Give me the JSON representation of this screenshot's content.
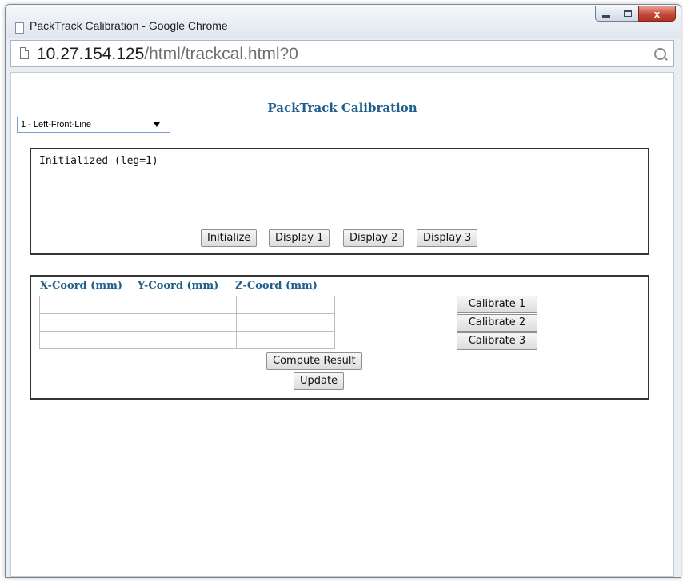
{
  "window": {
    "title": "PackTrack Calibration - Google Chrome",
    "controls": {
      "minimize": "minimize",
      "maximize": "maximize",
      "close": "x"
    }
  },
  "address_bar": {
    "host": "10.27.154.125",
    "path": "/html/trackcal.html?0"
  },
  "page": {
    "title": "PackTrack Calibration",
    "leg_select": {
      "selected": "1 - Left-Front-Line"
    },
    "status": {
      "text": "Initialized (leg=1)",
      "buttons": {
        "initialize": "Initialize",
        "display1": "Display 1",
        "display2": "Display 2",
        "display3": "Display 3"
      }
    },
    "coords": {
      "headers": {
        "x": "X-Coord (mm)",
        "y": "Y-Coord (mm)",
        "z": "Z-Coord (mm)"
      },
      "rows": [
        [
          "",
          "",
          ""
        ],
        [
          "",
          "",
          ""
        ],
        [
          "",
          "",
          ""
        ]
      ],
      "buttons": {
        "calibrate1": "Calibrate 1",
        "calibrate2": "Calibrate 2",
        "calibrate3": "Calibrate 3",
        "compute": "Compute Result",
        "update": "Update"
      }
    }
  },
  "colors": {
    "heading_blue": "#1f5f8b",
    "close_button_red": "#c4473a"
  }
}
